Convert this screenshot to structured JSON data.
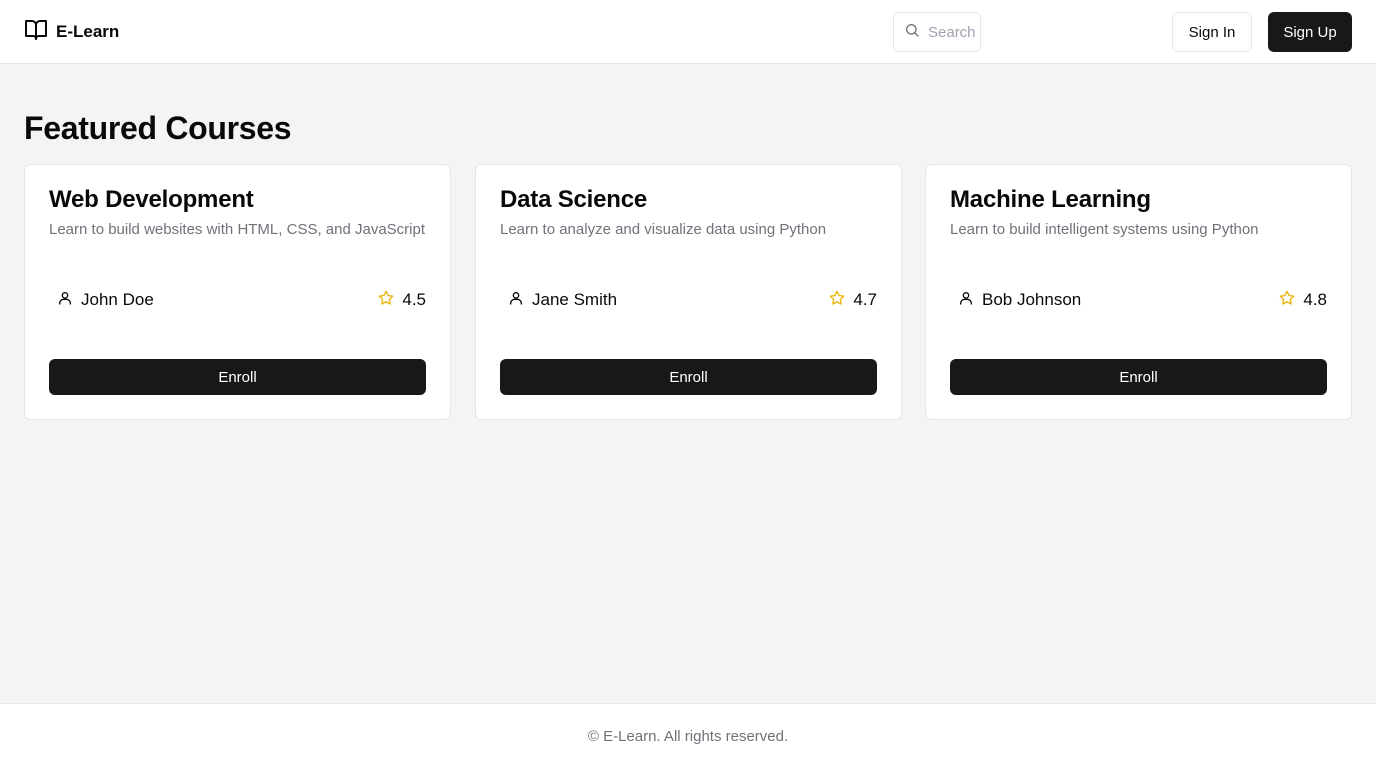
{
  "header": {
    "brand_name": "E-Learn",
    "search_placeholder": "Search",
    "signin_label": "Sign In",
    "signup_label": "Sign Up",
    "icons": {
      "logo": "book-open-icon",
      "search": "search-icon"
    }
  },
  "main": {
    "title": "Featured Courses",
    "courses": [
      {
        "title": "Web Development",
        "description": "Learn to build websites with HTML, CSS, and JavaScript",
        "instructor": "John Doe",
        "rating": "4.5",
        "enroll_label": "Enroll"
      },
      {
        "title": "Data Science",
        "description": "Learn to analyze and visualize data using Python",
        "instructor": "Jane Smith",
        "rating": "4.7",
        "enroll_label": "Enroll"
      },
      {
        "title": "Machine Learning",
        "description": "Learn to build intelligent systems using Python",
        "instructor": "Bob Johnson",
        "rating": "4.8",
        "enroll_label": "Enroll"
      }
    ]
  },
  "footer": {
    "text": "© E-Learn. All rights reserved."
  },
  "colors": {
    "primary": "#18181b",
    "star": "#eab308",
    "muted_text": "#71717a",
    "page_bg": "#f3f4f6"
  }
}
